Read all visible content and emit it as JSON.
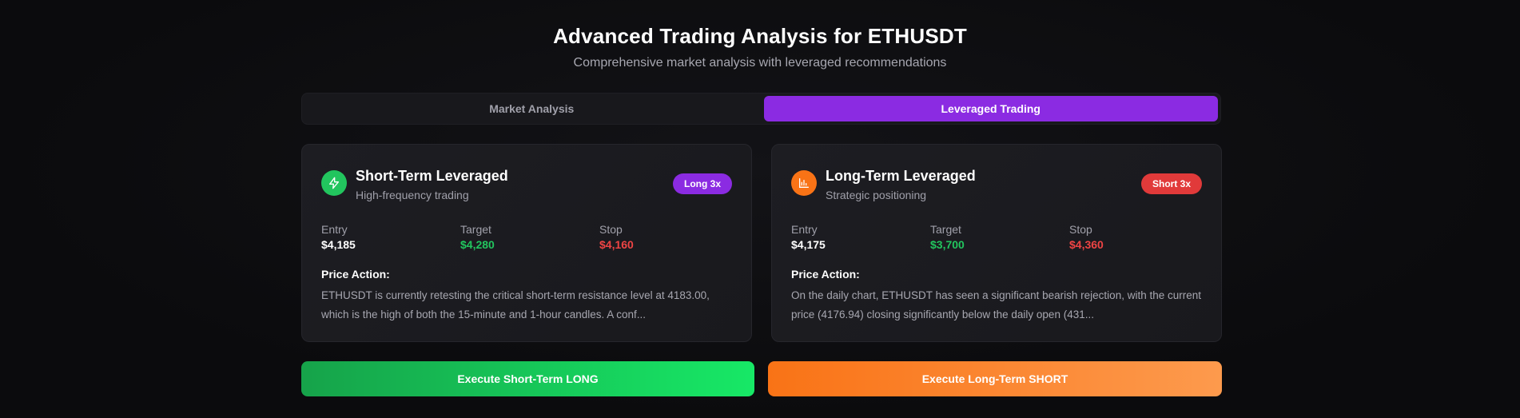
{
  "header": {
    "title": "Advanced Trading Analysis for ETHUSDT",
    "subtitle": "Comprehensive market analysis with leveraged recommendations"
  },
  "tabs": [
    {
      "label": "Market Analysis",
      "active": false
    },
    {
      "label": "Leveraged Trading",
      "active": true
    }
  ],
  "cards": [
    {
      "icon": "lightning-icon",
      "icon_color": "#22c55e",
      "title": "Short-Term Leveraged",
      "subtitle": "High-frequency trading",
      "badge": "Long 3x",
      "badge_color": "#8b2be2",
      "entry_label": "Entry",
      "entry": "$4,185",
      "target_label": "Target",
      "target": "$4,280",
      "stop_label": "Stop",
      "stop": "$4,160",
      "price_action_label": "Price Action:",
      "price_action": "ETHUSDT is currently retesting the critical short-term resistance level at 4183.00, which is the high of both the 15-minute and 1-hour candles. A conf..."
    },
    {
      "icon": "bar-chart-icon",
      "icon_color": "#f97316",
      "title": "Long-Term Leveraged",
      "subtitle": "Strategic positioning",
      "badge": "Short 3x",
      "badge_color": "#e13a3a",
      "entry_label": "Entry",
      "entry": "$4,175",
      "target_label": "Target",
      "target": "$3,700",
      "stop_label": "Stop",
      "stop": "$4,360",
      "price_action_label": "Price Action:",
      "price_action": "On the daily chart, ETHUSDT has seen a significant bearish rejection, with the current price (4176.94) closing significantly below the daily open (431..."
    }
  ],
  "actions": {
    "long_label": "Execute Short-Term LONG",
    "short_label": "Execute Long-Term SHORT"
  },
  "colors": {
    "accent_purple": "#8b2be2",
    "positive_green": "#22c55e",
    "negative_red": "#ef4444",
    "orange": "#f97316"
  }
}
